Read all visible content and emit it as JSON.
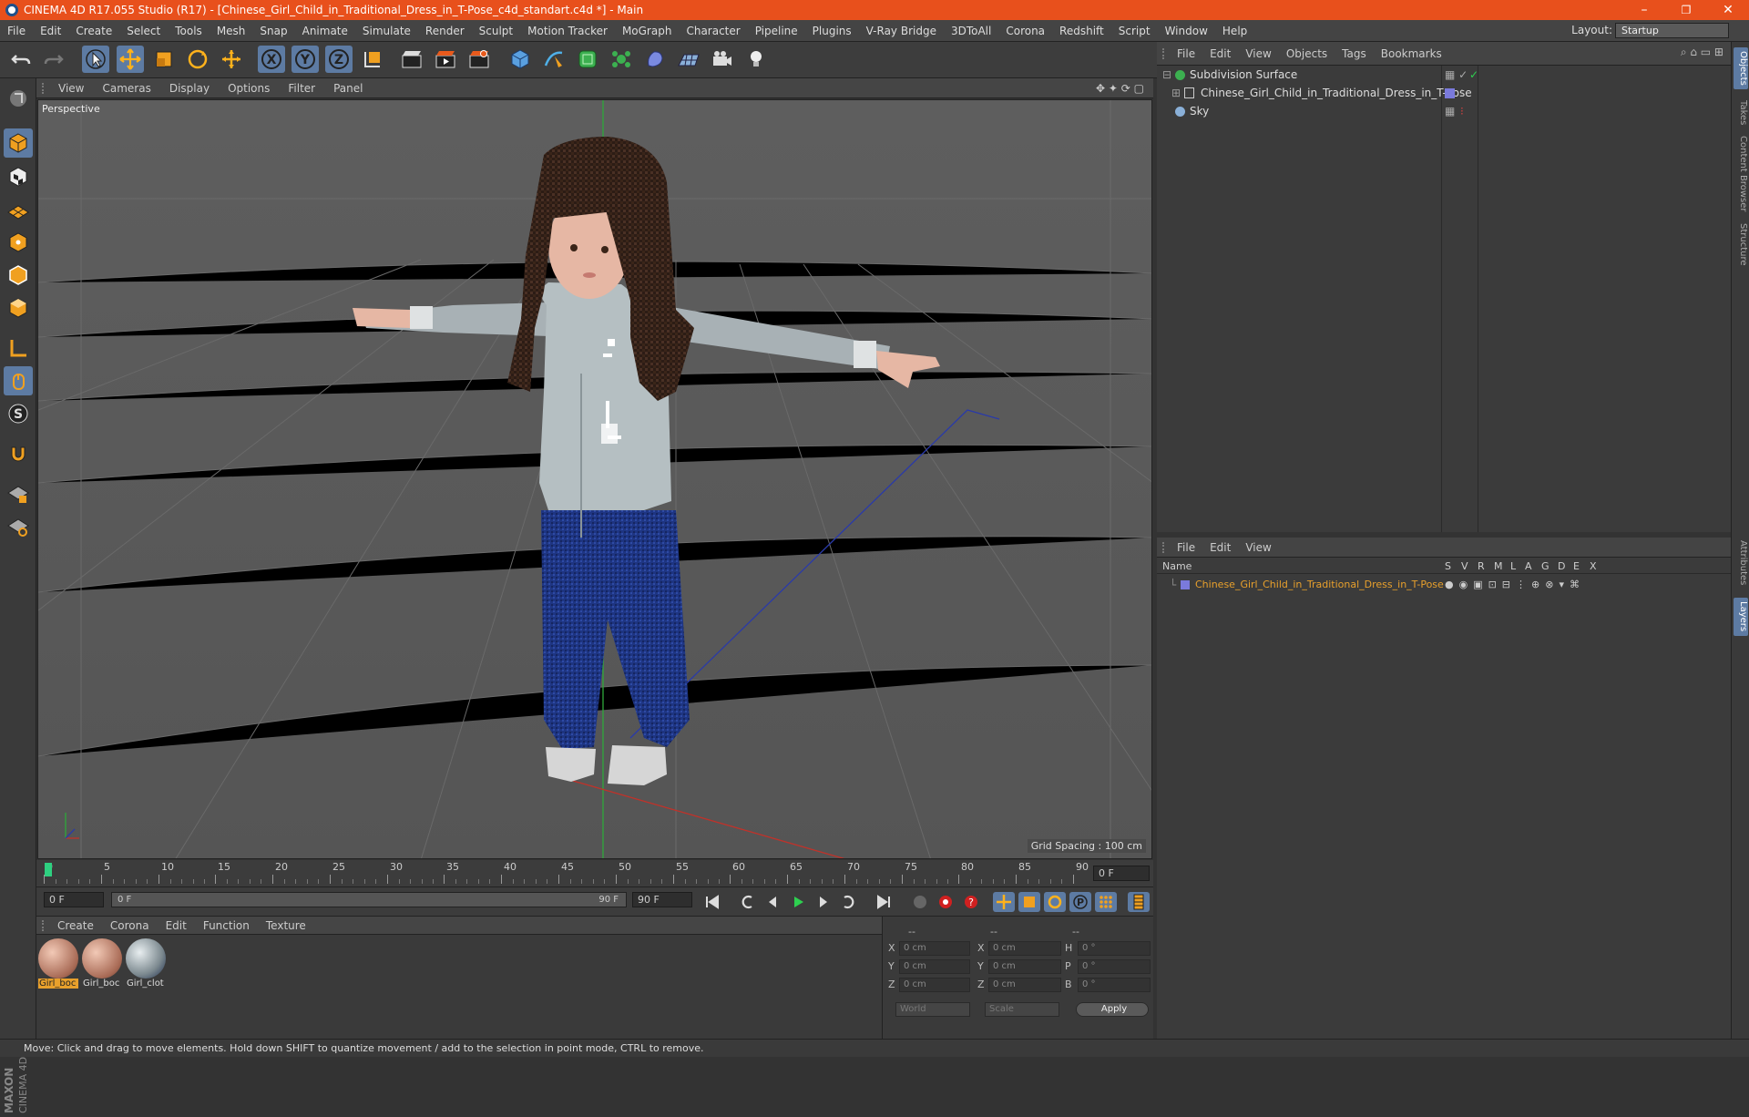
{
  "window": {
    "title": "CINEMA 4D R17.055 Studio (R17) - [Chinese_Girl_Child_in_Traditional_Dress_in_T-Pose_c4d_standart.c4d *] - Main",
    "controls": {
      "minimize": "–",
      "restore": "❐",
      "close": "✕"
    }
  },
  "menubar": {
    "items": [
      "File",
      "Edit",
      "Create",
      "Select",
      "Tools",
      "Mesh",
      "Snap",
      "Animate",
      "Simulate",
      "Render",
      "Sculpt",
      "Motion Tracker",
      "MoGraph",
      "Character",
      "Pipeline",
      "Plugins",
      "V-Ray Bridge",
      "3DToAll",
      "Corona",
      "Redshift",
      "Script",
      "Window",
      "Help"
    ],
    "layout_label": "Layout:",
    "layout_value": "Startup"
  },
  "viewport": {
    "menu": [
      "View",
      "Cameras",
      "Display",
      "Options",
      "Filter",
      "Panel"
    ],
    "label": "Perspective",
    "grid_spacing": "Grid Spacing : 100 cm"
  },
  "timeline": {
    "ticks": [
      "0",
      "5",
      "10",
      "15",
      "20",
      "25",
      "30",
      "35",
      "40",
      "45",
      "50",
      "55",
      "60",
      "65",
      "70",
      "75",
      "80",
      "85",
      "90"
    ],
    "current_frame": "0 F",
    "start_field": "0 F",
    "range_start": "0 F",
    "range_end": "90 F",
    "end_field": "90 F"
  },
  "materials": {
    "menu": [
      "Create",
      "Corona",
      "Edit",
      "Function",
      "Texture"
    ],
    "items": [
      {
        "label": "Girl_boc",
        "selected": true
      },
      {
        "label": "Girl_boc",
        "selected": false
      },
      {
        "label": "Girl_clot",
        "selected": false
      }
    ]
  },
  "coords": {
    "headers": [
      "--",
      "--",
      "--"
    ],
    "rows": [
      {
        "axis": "X",
        "pos": "0 cm",
        "axis2": "X",
        "size": "0 cm",
        "rot_axis": "H",
        "rot": "0 °"
      },
      {
        "axis": "Y",
        "pos": "0 cm",
        "axis2": "Y",
        "size": "0 cm",
        "rot_axis": "P",
        "rot": "0 °"
      },
      {
        "axis": "Z",
        "pos": "0 cm",
        "axis2": "Z",
        "size": "0 cm",
        "rot_axis": "B",
        "rot": "0 °"
      }
    ],
    "world_select": "World",
    "scale_select": "Scale",
    "apply_label": "Apply"
  },
  "objects": {
    "menu": [
      "File",
      "Edit",
      "View",
      "Objects",
      "Tags",
      "Bookmarks"
    ],
    "items": [
      {
        "name": "Subdivision Surface",
        "indent": 0
      },
      {
        "name": "Chinese_Girl_Child_in_Traditional_Dress_in_T-Pose",
        "indent": 1
      },
      {
        "name": "Sky",
        "indent": 0
      }
    ]
  },
  "layers": {
    "menu": [
      "File",
      "Edit",
      "View"
    ],
    "name_header": "Name",
    "column_headers": [
      "S",
      "V",
      "R",
      "M",
      "L",
      "A",
      "G",
      "D",
      "E",
      "X"
    ],
    "items": [
      {
        "name": "Chinese_Girl_Child_in_Traditional_Dress_in_T-Pose",
        "color": "#7a7adc"
      }
    ]
  },
  "right_tabs": [
    "Objects",
    "Takes",
    "Content Browser",
    "Structure",
    "Attributes",
    "Layers"
  ],
  "status": "Move: Click and drag to move elements. Hold down SHIFT to quantize movement / add to the selection in point mode, CTRL to remove.",
  "brand": {
    "line1": "MAXON",
    "line2": "CINEMA 4D"
  },
  "colors": {
    "titlebar": "#e8501c",
    "accent_blue": "#5d7ba3",
    "layer_name": "#e8a02c"
  }
}
